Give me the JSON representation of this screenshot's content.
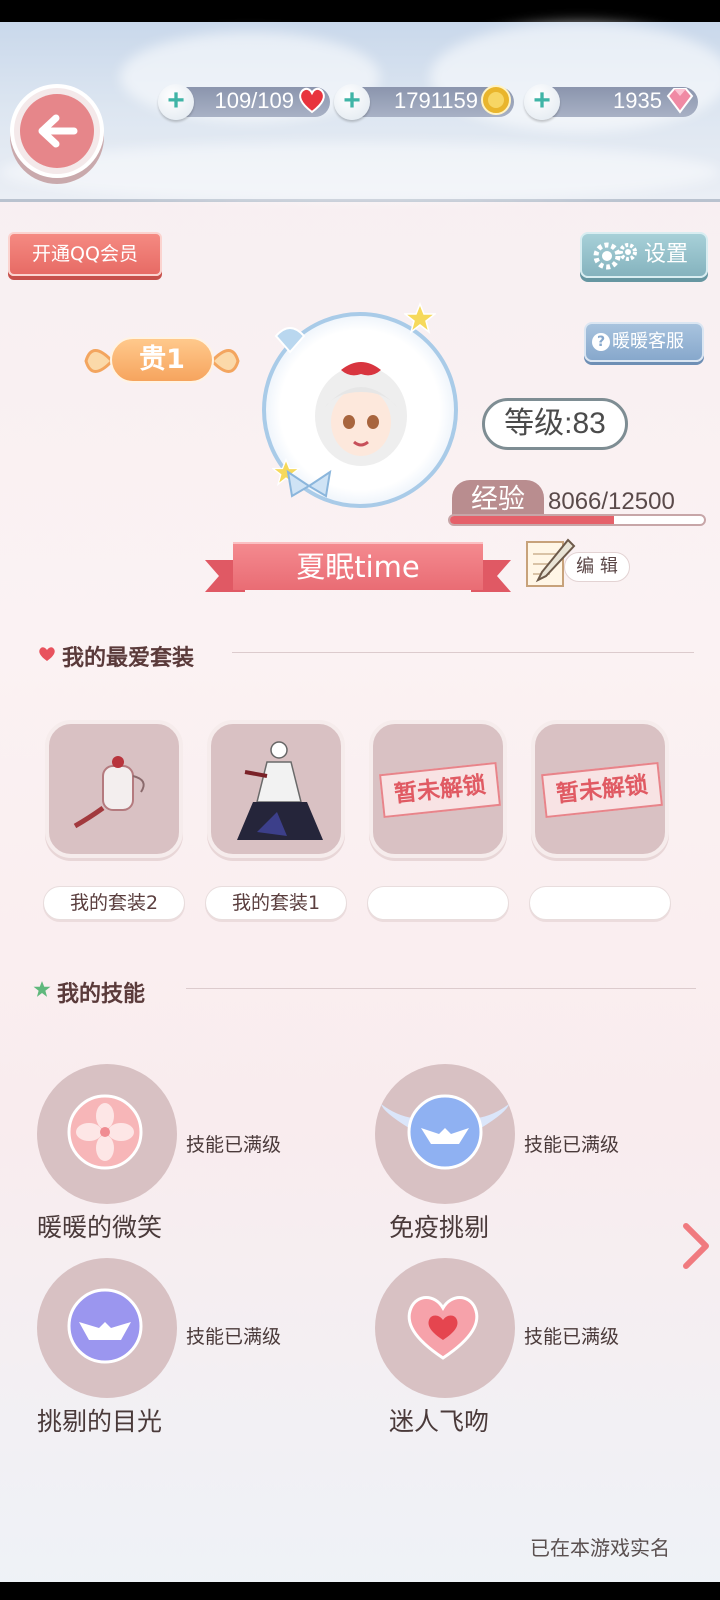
{
  "resources": {
    "stamina": "109/109",
    "gold": "1791159",
    "diamonds": "1935"
  },
  "buttons": {
    "qq_member": "开通QQ会员",
    "settings": "设置",
    "customer_service": "暖暖客服",
    "edit": "编 辑"
  },
  "profile": {
    "noble_rank": "贵1",
    "level": "等级:83",
    "exp_label": "经验",
    "exp_value": "8066/12500",
    "exp_progress": 0.645,
    "name": "夏眠time"
  },
  "favorites": {
    "title": "我的最爱套装",
    "items": [
      {
        "label": "我的套装2",
        "locked": false
      },
      {
        "label": "我的套装1",
        "locked": false
      },
      {
        "label": "",
        "locked": true
      },
      {
        "label": "",
        "locked": true
      }
    ],
    "locked_text": "暂未解锁"
  },
  "skills": {
    "title": "我的技能",
    "status": "技能已满级",
    "items": [
      {
        "name": "暖暖的微笑",
        "icon": "sakura-icon"
      },
      {
        "name": "免疫挑剔",
        "icon": "winged-mask-icon"
      },
      {
        "name": "挑剔的目光",
        "icon": "mask-icon"
      },
      {
        "name": "迷人飞吻",
        "icon": "heart-icon"
      }
    ]
  },
  "footer": {
    "realname": "已在本游戏实名"
  },
  "colors": {
    "accent_red": "#e96c74",
    "exp_fill": "#e5616a",
    "card_bg": "#d9c1c3"
  }
}
